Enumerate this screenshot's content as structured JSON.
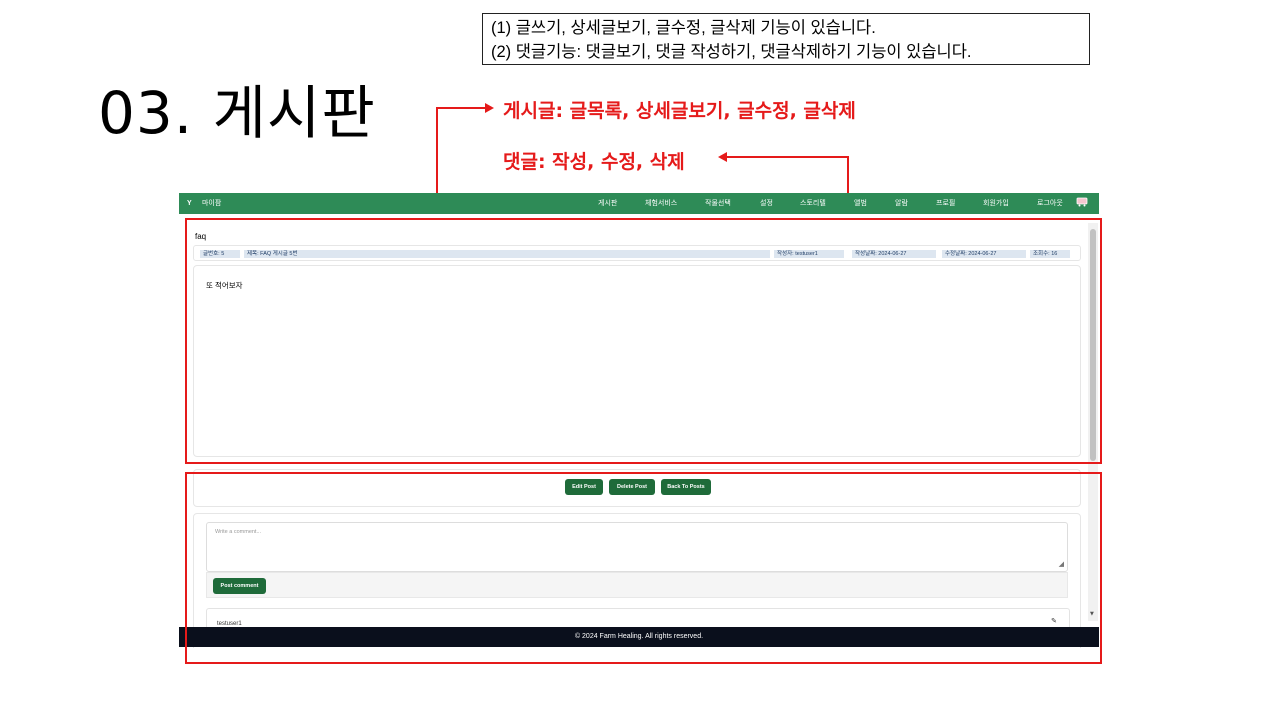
{
  "slide": {
    "title": "03. 게시판",
    "notes": [
      "(1) 글쓰기, 상세글보기, 글수정, 글삭제 기능이 있습니다.",
      "(2) 댓글기능: 댓글보기, 댓글 작성하기, 댓글삭제하기 기능이 있습니다."
    ],
    "annotations": {
      "post": "게시글: 글목록, 상세글보기, 글수정, 글삭제",
      "comment": "댓글: 작성, 수정, 삭제"
    },
    "annotation_color": "#e51a1a"
  },
  "app": {
    "brand": "마이팜",
    "nav_color": "#2e8b57",
    "nav_items": [
      "게시판",
      "체험서비스",
      "작물선택",
      "설정",
      "스토리텔",
      "앨범",
      "알람",
      "프로필",
      "회원가입",
      "로그아웃"
    ],
    "cart_icon": "cart-icon",
    "post": {
      "title": "faq",
      "meta": {
        "number": "글번호: 5",
        "subject": "제목: FAQ 게시글 5번",
        "author": "작성자: testuser1",
        "created": "작성날짜: 2024-06-27",
        "modified": "수정날짜: 2024-06-27",
        "views": "조회수: 16"
      },
      "body": "또 적어보자"
    },
    "buttons": {
      "edit": "Edit Post",
      "delete": "Delete Post",
      "back": "Back To Posts"
    },
    "button_color": "#1f6b3a",
    "comment": {
      "placeholder": "Write a comment...",
      "submit": "Post comment",
      "first_author": "testuser1"
    },
    "footer": "© 2024 Farm Healing. All rights reserved."
  }
}
